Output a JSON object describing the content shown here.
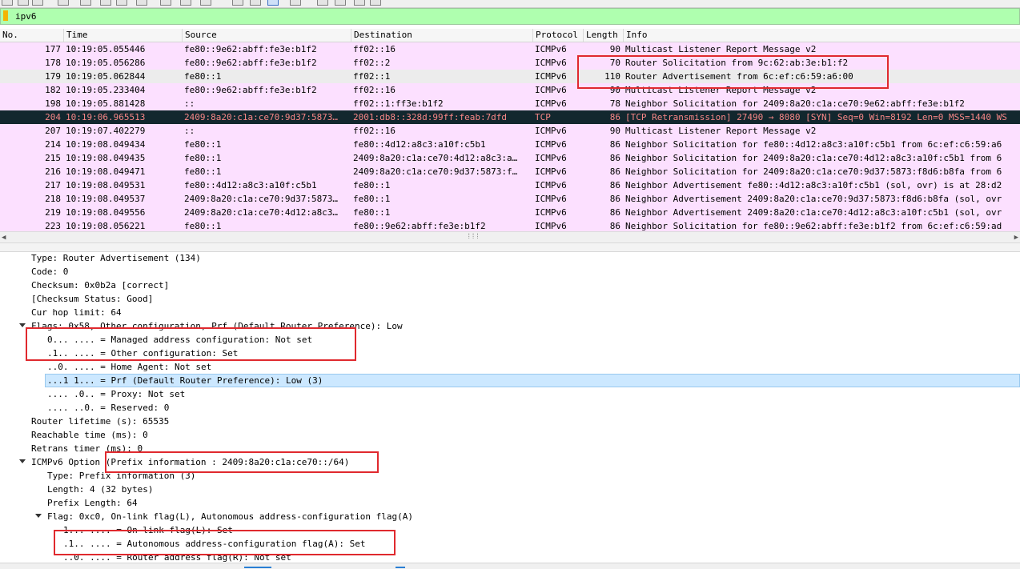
{
  "filter": {
    "value": "ipv6"
  },
  "columns": {
    "no": "No.",
    "time": "Time",
    "source": "Source",
    "destination": "Destination",
    "protocol": "Protocol",
    "length": "Length",
    "info": "Info"
  },
  "packets": [
    {
      "no": "177",
      "time": "10:19:05.055446",
      "src": "fe80::9e62:abff:fe3e:b1f2",
      "dst": "ff02::16",
      "proto": "ICMPv6",
      "len": "90",
      "info": "Multicast Listener Report Message v2"
    },
    {
      "no": "178",
      "time": "10:19:05.056286",
      "src": "fe80::9e62:abff:fe3e:b1f2",
      "dst": "ff02::2",
      "proto": "ICMPv6",
      "len": "70",
      "info": "Router Solicitation from 9c:62:ab:3e:b1:f2"
    },
    {
      "no": "179",
      "time": "10:19:05.062844",
      "src": "fe80::1",
      "dst": "ff02::1",
      "proto": "ICMPv6",
      "len": "110",
      "info": "Router Advertisement from 6c:ef:c6:59:a6:00"
    },
    {
      "no": "182",
      "time": "10:19:05.233404",
      "src": "fe80::9e62:abff:fe3e:b1f2",
      "dst": "ff02::16",
      "proto": "ICMPv6",
      "len": "90",
      "info": "Multicast Listener Report Message v2"
    },
    {
      "no": "198",
      "time": "10:19:05.881428",
      "src": "::",
      "dst": "ff02::1:ff3e:b1f2",
      "proto": "ICMPv6",
      "len": "78",
      "info": "Neighbor Solicitation for 2409:8a20:c1a:ce70:9e62:abff:fe3e:b1f2"
    },
    {
      "no": "204",
      "time": "10:19:06.965513",
      "src": "2409:8a20:c1a:ce70:9d37:5873…",
      "dst": "2001:db8::328d:99ff:feab:7dfd",
      "proto": "TCP",
      "len": "86",
      "info": "[TCP Retransmission] 27490 → 8080 [SYN] Seq=0 Win=8192 Len=0 MSS=1440 WS"
    },
    {
      "no": "207",
      "time": "10:19:07.402279",
      "src": "::",
      "dst": "ff02::16",
      "proto": "ICMPv6",
      "len": "90",
      "info": "Multicast Listener Report Message v2"
    },
    {
      "no": "214",
      "time": "10:19:08.049434",
      "src": "fe80::1",
      "dst": "fe80::4d12:a8c3:a10f:c5b1",
      "proto": "ICMPv6",
      "len": "86",
      "info": "Neighbor Solicitation for fe80::4d12:a8c3:a10f:c5b1 from 6c:ef:c6:59:a6"
    },
    {
      "no": "215",
      "time": "10:19:08.049435",
      "src": "fe80::1",
      "dst": "2409:8a20:c1a:ce70:4d12:a8c3:a…",
      "proto": "ICMPv6",
      "len": "86",
      "info": "Neighbor Solicitation for 2409:8a20:c1a:ce70:4d12:a8c3:a10f:c5b1 from 6"
    },
    {
      "no": "216",
      "time": "10:19:08.049471",
      "src": "fe80::1",
      "dst": "2409:8a20:c1a:ce70:9d37:5873:f…",
      "proto": "ICMPv6",
      "len": "86",
      "info": "Neighbor Solicitation for 2409:8a20:c1a:ce70:9d37:5873:f8d6:b8fa from 6"
    },
    {
      "no": "217",
      "time": "10:19:08.049531",
      "src": "fe80::4d12:a8c3:a10f:c5b1",
      "dst": "fe80::1",
      "proto": "ICMPv6",
      "len": "86",
      "info": "Neighbor Advertisement fe80::4d12:a8c3:a10f:c5b1 (sol, ovr) is at 28:d2"
    },
    {
      "no": "218",
      "time": "10:19:08.049537",
      "src": "2409:8a20:c1a:ce70:9d37:5873…",
      "dst": "fe80::1",
      "proto": "ICMPv6",
      "len": "86",
      "info": "Neighbor Advertisement 2409:8a20:c1a:ce70:9d37:5873:f8d6:b8fa (sol, ovr"
    },
    {
      "no": "219",
      "time": "10:19:08.049556",
      "src": "2409:8a20:c1a:ce70:4d12:a8c3…",
      "dst": "fe80::1",
      "proto": "ICMPv6",
      "len": "86",
      "info": "Neighbor Advertisement 2409:8a20:c1a:ce70:4d12:a8c3:a10f:c5b1 (sol, ovr"
    },
    {
      "no": "223",
      "time": "10:19:08.056221",
      "src": "fe80::1",
      "dst": "fe80::9e62:abff:fe3e:b1f2",
      "proto": "ICMPv6",
      "len": "86",
      "info": "Neighbor Solicitation for fe80::9e62:abff:fe3e:b1f2 from 6c:ef:c6:59:ad"
    }
  ],
  "details": [
    {
      "text": "Type: Router Advertisement (134)"
    },
    {
      "text": "Code: 0"
    },
    {
      "text": "Checksum: 0x0b2a [correct]"
    },
    {
      "text": "[Checksum Status: Good]"
    },
    {
      "text": "Cur hop limit: 64"
    },
    {
      "text": "Flags: 0x58, Other configuration, Prf (Default Router Preference): Low"
    },
    {
      "text": "0... .... = Managed address configuration: Not set"
    },
    {
      "text": ".1.. .... = Other configuration: Set"
    },
    {
      "text": "..0. .... = Home Agent: Not set"
    },
    {
      "text": "...1 1... = Prf (Default Router Preference): Low (3)"
    },
    {
      "text": ".... .0.. = Proxy: Not set"
    },
    {
      "text": ".... ..0. = Reserved: 0"
    },
    {
      "text": "Router lifetime (s): 65535"
    },
    {
      "text": "Reachable time (ms): 0"
    },
    {
      "text": "Retrans timer (ms): 0"
    },
    {
      "text": "ICMPv6 Option (Prefix information : 2409:8a20:c1a:ce70::/64)"
    },
    {
      "text": "Type: Prefix information (3)"
    },
    {
      "text": "Length: 4 (32 bytes)"
    },
    {
      "text": "Prefix Length: 64"
    },
    {
      "text": "Flag: 0xc0, On-link flag(L), Autonomous address-configuration flag(A)"
    },
    {
      "text": "1... .... = On-link flag(L): Set"
    },
    {
      "text": ".1.. .... = Autonomous address-configuration flag(A): Set"
    },
    {
      "text": "..0. .... = Router address flag(R): Not set"
    }
  ],
  "scroll": {
    "left": "◀",
    "right": "▶",
    "grip": "⁞⁞⁞"
  },
  "colors": {
    "filter_bg": "#afffaf",
    "row_icmpv6": "#fce0ff",
    "row_selected_bg": "#12272e",
    "row_selected_fg": "#f78787",
    "annotation": "#e0292e",
    "detail_highlight": "#cce8ff"
  }
}
